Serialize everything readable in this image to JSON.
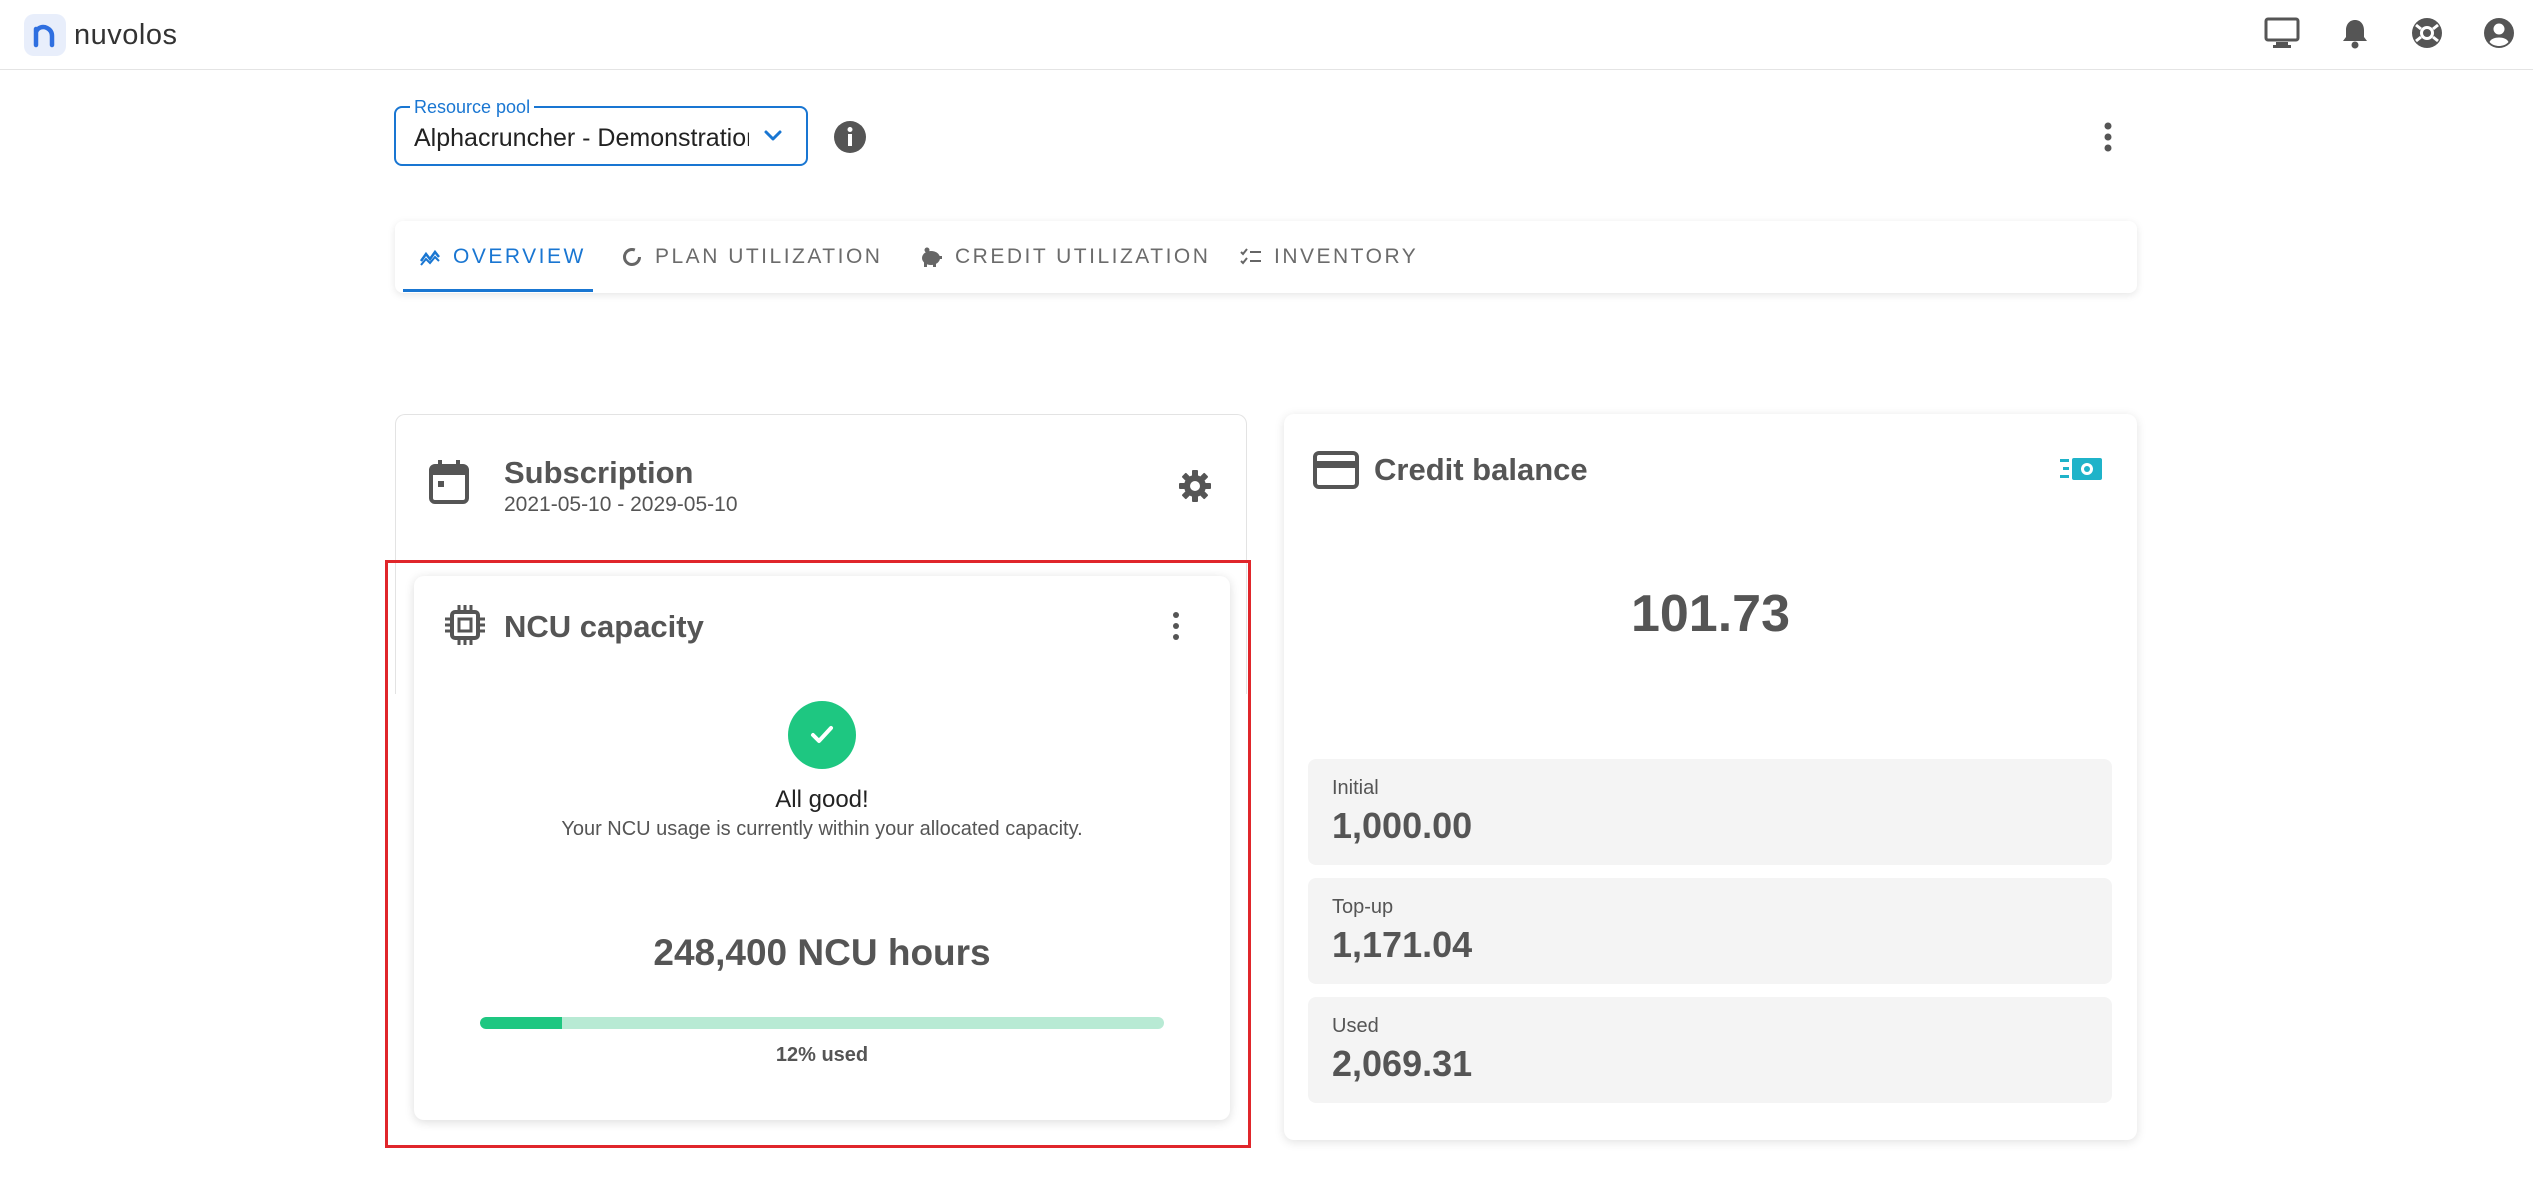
{
  "app": {
    "name": "nuvolos"
  },
  "resource_pool": {
    "label": "Resource pool",
    "value": "Alphacruncher - Demonstration"
  },
  "tabs": [
    {
      "label": "OVERVIEW",
      "icon": "trend-icon",
      "active": true
    },
    {
      "label": "PLAN UTILIZATION",
      "icon": "donut-icon",
      "active": false
    },
    {
      "label": "CREDIT UTILIZATION",
      "icon": "piggy-bank-icon",
      "active": false
    },
    {
      "label": "INVENTORY",
      "icon": "checklist-icon",
      "active": false
    }
  ],
  "subscription": {
    "title": "Subscription",
    "dates": "2021-05-10 - 2029-05-10"
  },
  "ncu": {
    "title": "NCU capacity",
    "status_title": "All good!",
    "status_text": "Your NCU usage is currently within your allocated capacity.",
    "hours": "248,400 NCU hours",
    "used_fraction": 0.12,
    "used_label": "12% used"
  },
  "credit": {
    "title": "Credit balance",
    "balance": "101.73",
    "stats": [
      {
        "label": "Initial",
        "value": "1,000.00"
      },
      {
        "label": "Top-up",
        "value": "1,171.04"
      },
      {
        "label": "Used",
        "value": "2,069.31"
      }
    ]
  },
  "colors": {
    "primary": "#1976d2",
    "success": "#1ec781",
    "success_light": "#b8ead4",
    "highlight": "#e0262b",
    "teal_icon": "#1fb3c9"
  }
}
